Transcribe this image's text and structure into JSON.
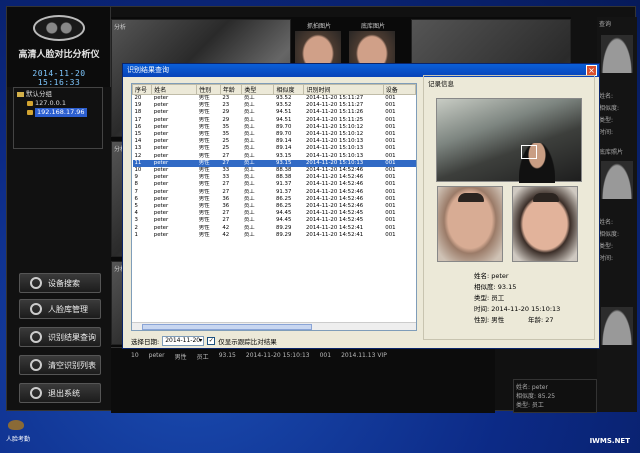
{
  "app": {
    "title": "高清人脸对比分析仪",
    "clock": "2014-11-20 15:16:33"
  },
  "tree": {
    "root": "默认分组",
    "items": [
      "127.0.0.1",
      "192.168.17.96"
    ]
  },
  "menu": [
    {
      "label": "设备搜索",
      "icon": "search-icon"
    },
    {
      "label": "人脸库管理",
      "icon": "gear-icon"
    },
    {
      "label": "识别结果查询",
      "icon": "table-icon"
    },
    {
      "label": "清空识别列表",
      "icon": "broom-icon"
    },
    {
      "label": "退出系统",
      "icon": "exit-icon"
    }
  ],
  "video": {
    "face_labels": [
      "抓拍图片",
      "底库图片"
    ],
    "tile_label": "分析",
    "right_label": "查询"
  },
  "right_panel": {
    "labels": [
      "姓名:",
      "相似度:",
      "类型:",
      "时间:",
      "姓名:",
      "相似度:",
      "类型:",
      "时间:",
      "底库照片"
    ]
  },
  "dialog": {
    "title": "识别结果查询",
    "close": "×",
    "columns": [
      "序号",
      "姓名",
      "性别",
      "年龄",
      "类型",
      "相似度",
      "识别时间",
      "设备"
    ],
    "rows": [
      [
        "20",
        "peter",
        "男性",
        "23",
        "员工",
        "93.52",
        "2014-11-20 15:11:27",
        "001"
      ],
      [
        "19",
        "peter",
        "男性",
        "23",
        "员工",
        "93.52",
        "2014-11-20 15:11:27",
        "001"
      ],
      [
        "18",
        "peter",
        "男性",
        "29",
        "员工",
        "94.51",
        "2014-11-20 15:11:26",
        "001"
      ],
      [
        "17",
        "peter",
        "男性",
        "29",
        "员工",
        "94.51",
        "2014-11-20 15:11:25",
        "001"
      ],
      [
        "16",
        "peter",
        "男性",
        "35",
        "员工",
        "89.70",
        "2014-11-20 15:10:12",
        "001"
      ],
      [
        "15",
        "peter",
        "男性",
        "35",
        "员工",
        "89.70",
        "2014-11-20 15:10:12",
        "001"
      ],
      [
        "14",
        "peter",
        "男性",
        "25",
        "员工",
        "89.14",
        "2014-11-20 15:10:13",
        "001"
      ],
      [
        "13",
        "peter",
        "男性",
        "25",
        "员工",
        "89.14",
        "2014-11-20 15:10:13",
        "001"
      ],
      [
        "12",
        "peter",
        "男性",
        "27",
        "员工",
        "93.15",
        "2014-11-20 15:10:13",
        "001"
      ],
      [
        "11",
        "peter",
        "男性",
        "27",
        "员工",
        "93.15",
        "2014-11-20 15:10:13",
        "001"
      ],
      [
        "10",
        "peter",
        "男性",
        "33",
        "员工",
        "88.38",
        "2014-11-20 14:52:46",
        "001"
      ],
      [
        "9",
        "peter",
        "男性",
        "33",
        "员工",
        "88.38",
        "2014-11-20 14:52:46",
        "001"
      ],
      [
        "8",
        "peter",
        "男性",
        "27",
        "员工",
        "91.37",
        "2014-11-20 14:52:46",
        "001"
      ],
      [
        "7",
        "peter",
        "男性",
        "27",
        "员工",
        "91.37",
        "2014-11-20 14:52:46",
        "001"
      ],
      [
        "6",
        "peter",
        "男性",
        "36",
        "员工",
        "86.25",
        "2014-11-20 14:52:46",
        "001"
      ],
      [
        "5",
        "peter",
        "男性",
        "36",
        "员工",
        "86.25",
        "2014-11-20 14:52:46",
        "001"
      ],
      [
        "4",
        "peter",
        "男性",
        "27",
        "员工",
        "94.45",
        "2014-11-20 14:52:45",
        "001"
      ],
      [
        "3",
        "peter",
        "男性",
        "27",
        "员工",
        "94.45",
        "2014-11-20 14:52:45",
        "001"
      ],
      [
        "2",
        "peter",
        "男性",
        "42",
        "员工",
        "89.29",
        "2014-11-20 14:52:41",
        "001"
      ],
      [
        "1",
        "peter",
        "男性",
        "42",
        "员工",
        "89.29",
        "2014-11-20 14:52:41",
        "001"
      ]
    ],
    "selected_row": 9,
    "filter": {
      "date_label": "选择日期:",
      "date_value": "2014-11-20",
      "checkbox_label": "仅显示跟踪比对结果",
      "checked": true
    },
    "detail": {
      "title": "记录信息",
      "name": "姓名: peter",
      "similarity": "相似度: 93.15",
      "type": "类型: 员工",
      "time": "时间: 2014-11-20 15:10:13",
      "gender": "性别: 男性",
      "age": "年龄: 27"
    }
  },
  "bottom_log": {
    "row": [
      "10",
      "peter",
      "男性",
      "员工",
      "93.15",
      "2014-11-20 15:10:13",
      "001",
      "2014.11.13 VIP"
    ]
  },
  "bottom_right": {
    "name": "姓名: peter",
    "similarity": "相似度: 85.25",
    "type": "类型: 员工"
  },
  "desktop": {
    "taskbar_label": "人脸考勤",
    "watermark": "IWMS.NET"
  }
}
